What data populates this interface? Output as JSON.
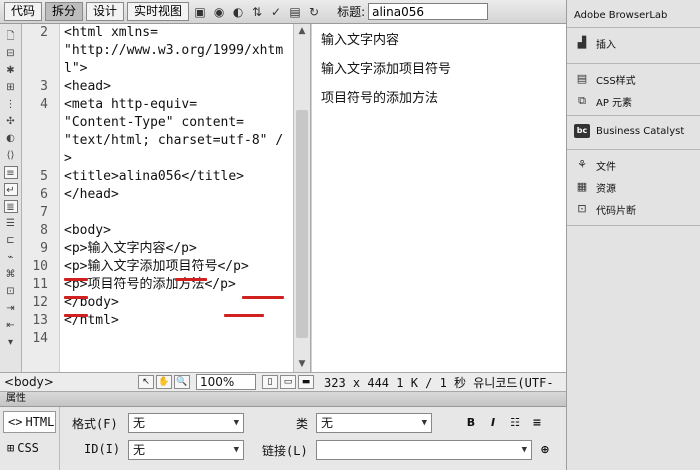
{
  "toolbar": {
    "buttons": [
      "代码",
      "拆分",
      "设计",
      "实时视图"
    ],
    "title_label": "标题:",
    "title_value": "alina056"
  },
  "code": {
    "lines": [
      {
        "num": "2",
        "text": "<html xmlns="
      },
      {
        "num": "",
        "text": "\"http://www.w3.org/1999/xhtm"
      },
      {
        "num": "",
        "text": "l\">"
      },
      {
        "num": "3",
        "text": "<head>"
      },
      {
        "num": "4",
        "text": "<meta http-equiv="
      },
      {
        "num": "",
        "text": "\"Content-Type\" content="
      },
      {
        "num": "",
        "text": "\"text/html; charset=utf-8\" /"
      },
      {
        "num": "",
        "text": ">"
      },
      {
        "num": "5",
        "text": "<title>alina056</title>"
      },
      {
        "num": "6",
        "text": "</head>"
      },
      {
        "num": "7",
        "text": ""
      },
      {
        "num": "8",
        "text": "<body>"
      },
      {
        "num": "9",
        "text": "<p>输入文字内容</p>"
      },
      {
        "num": "10",
        "text": "<p>输入文字添加项目符号</p>"
      },
      {
        "num": "11",
        "text": "<p>项目符号的添加方法</p>"
      },
      {
        "num": "12",
        "text": "</body>"
      },
      {
        "num": "13",
        "text": "</html>"
      },
      {
        "num": "14",
        "text": ""
      }
    ]
  },
  "design": {
    "paragraphs": [
      "输入文字内容",
      "输入文字添加项目符号",
      "项目符号的添加方法"
    ]
  },
  "status": {
    "tag": "<body>",
    "zoom": "100%",
    "info": "323 x 444 1 K / 1 秒 유니코드(UTF-"
  },
  "properties": {
    "header": "属性",
    "html_tab": "HTML",
    "css_tab": "CSS",
    "format_label": "格式(F)",
    "format_value": "无",
    "id_label": "ID(I)",
    "id_value": "无",
    "class_label": "类",
    "class_value": "无",
    "link_label": "链接(L)",
    "link_value": ""
  },
  "right_panel": {
    "browserlab": "Adobe BrowserLab",
    "insert": "插入",
    "css_styles": "CSS样式",
    "ap_elements": "AP 元素",
    "business_catalyst": "Business Catalyst",
    "files": "文件",
    "assets": "资源",
    "snippets": "代码片断"
  },
  "colors": {
    "annotation_underline": "#d02020"
  }
}
